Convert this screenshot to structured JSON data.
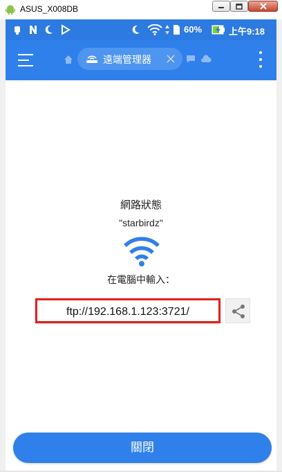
{
  "window": {
    "title": "ASUS_X008DB"
  },
  "status_bar": {
    "battery": "60%",
    "time": "上午9:18"
  },
  "app_bar": {
    "tab_label": "遠端管理器"
  },
  "content": {
    "network_title": "網路狀態",
    "ssid": "\"starbirdz\"",
    "enter_label": "在電腦中輸入：",
    "address": "ftp://192.168.1.123:3721/"
  },
  "footer": {
    "close_label": "關閉"
  },
  "colors": {
    "accent": "#2f80ea",
    "highlight_border": "#e0201a"
  }
}
